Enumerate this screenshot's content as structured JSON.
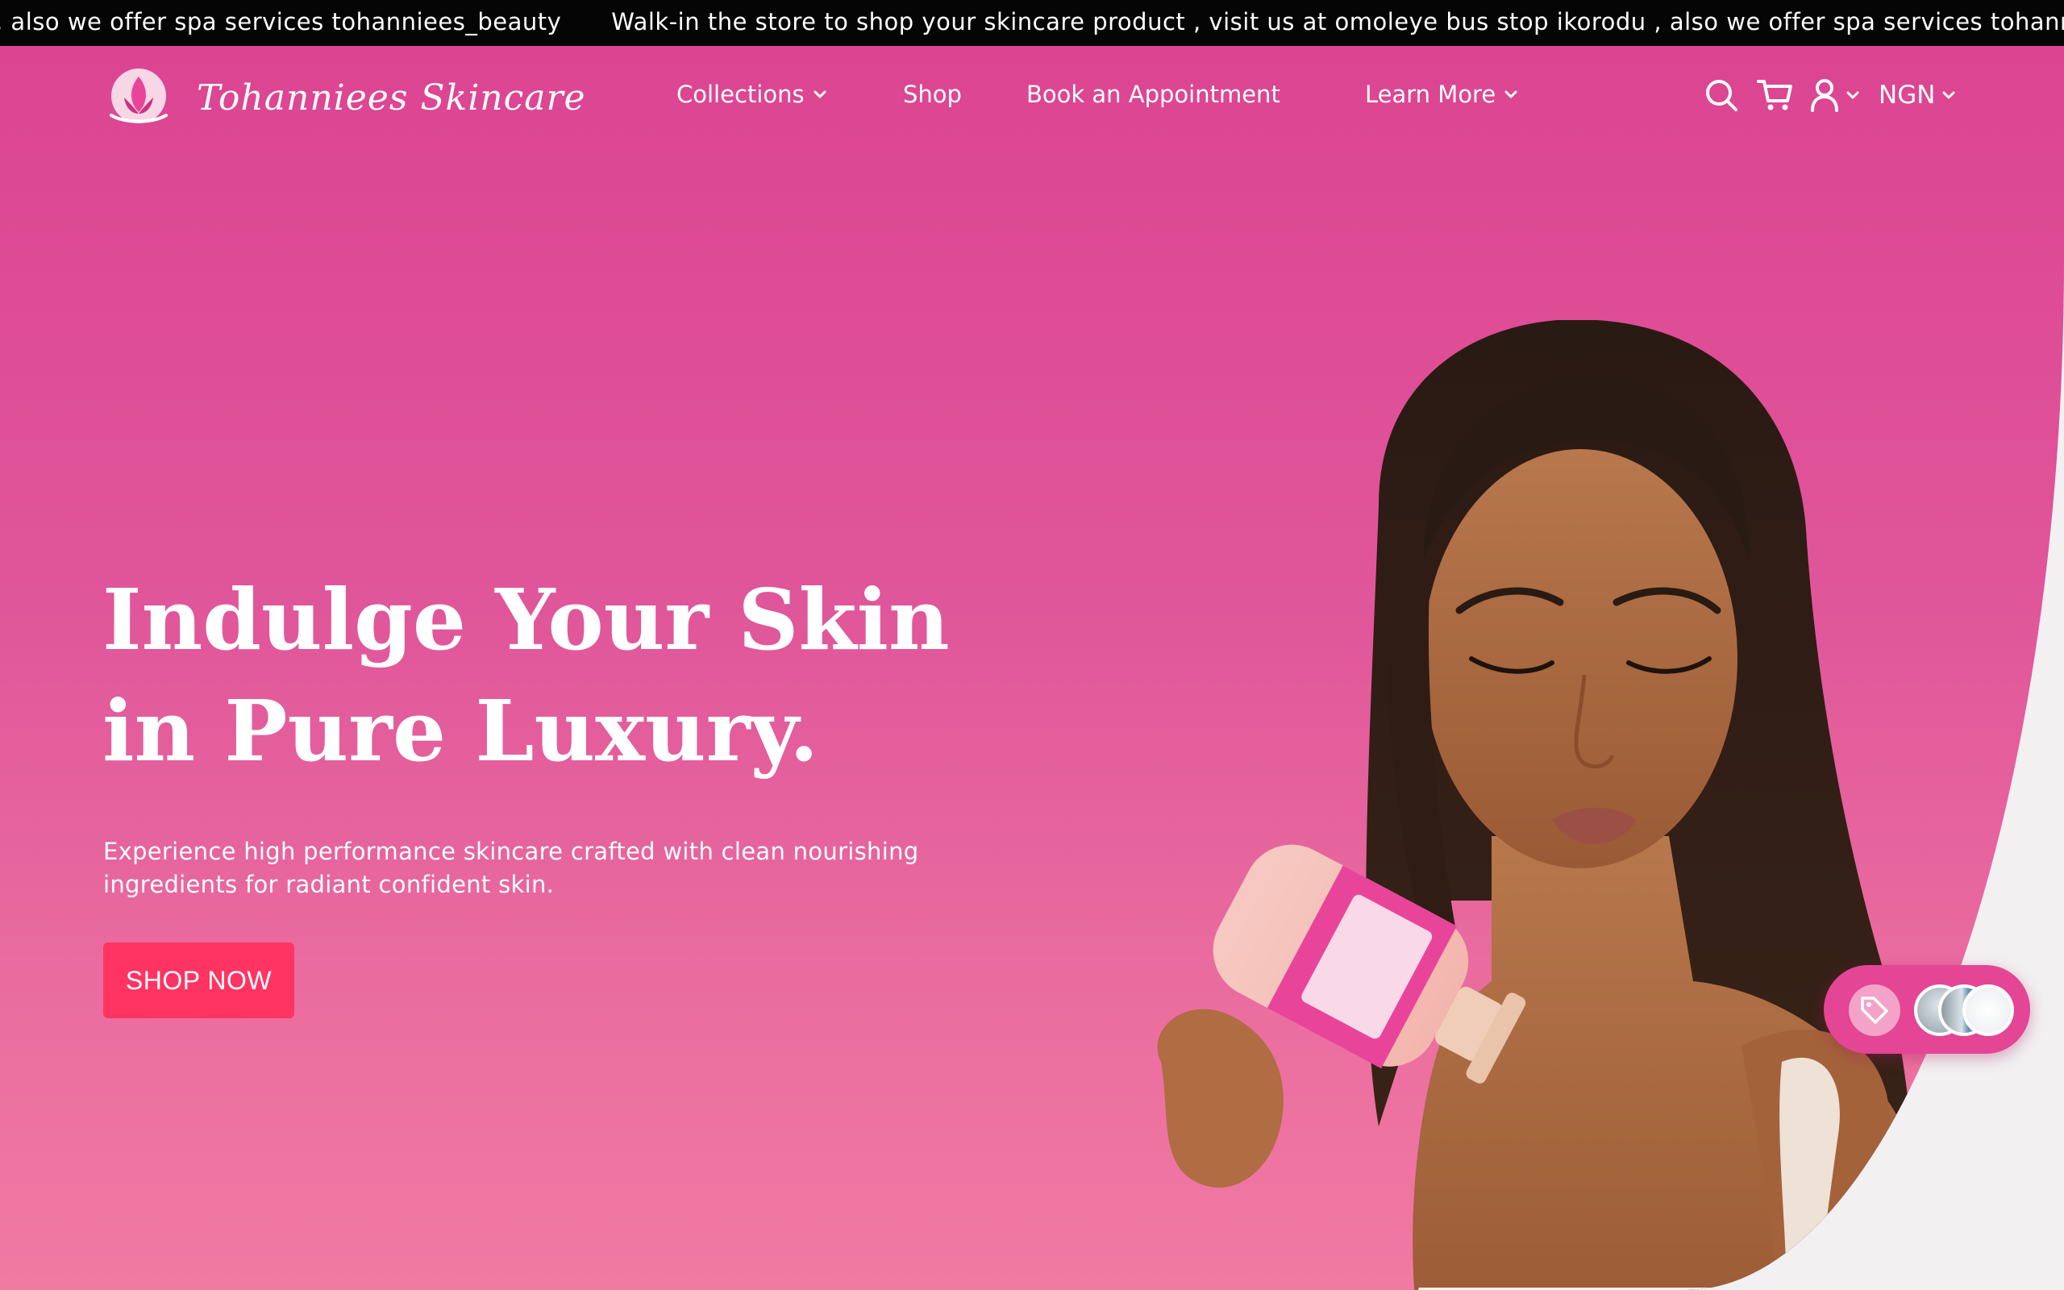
{
  "announcement": {
    "text": ", also we offer spa services tohanniees_beauty",
    "text_repeat": "Walk-in the store to shop your skincare product , visit us at omoleye bus stop ikorodu , also we offer spa services tohanniees_beauty"
  },
  "brand": {
    "name": "Tohanniees Skincare",
    "logo_icon": "lotus-logo-icon"
  },
  "nav": {
    "collections": "Collections",
    "shop": "Shop",
    "book": "Book an Appointment",
    "learn_more": "Learn More"
  },
  "utility": {
    "currency": "NGN",
    "icons": [
      "search-icon",
      "cart-icon",
      "account-icon"
    ]
  },
  "hero": {
    "headline_line1": "Indulge Your Skin",
    "headline_line2": "in Pure Luxury.",
    "subcopy": "Experience high performance skincare crafted with clean nourishing ingredients for radiant confident skin.",
    "cta": "SHOP NOW"
  },
  "floating_widget": {
    "icon": "tag-icon",
    "thumbnails": 3
  },
  "colors": {
    "hero_gradient_top": "#dc4492",
    "hero_gradient_bottom": "#f07aa2",
    "cta": "#ff3462",
    "announcement_bg": "#050505",
    "page_bg": "#f2f0f1"
  }
}
